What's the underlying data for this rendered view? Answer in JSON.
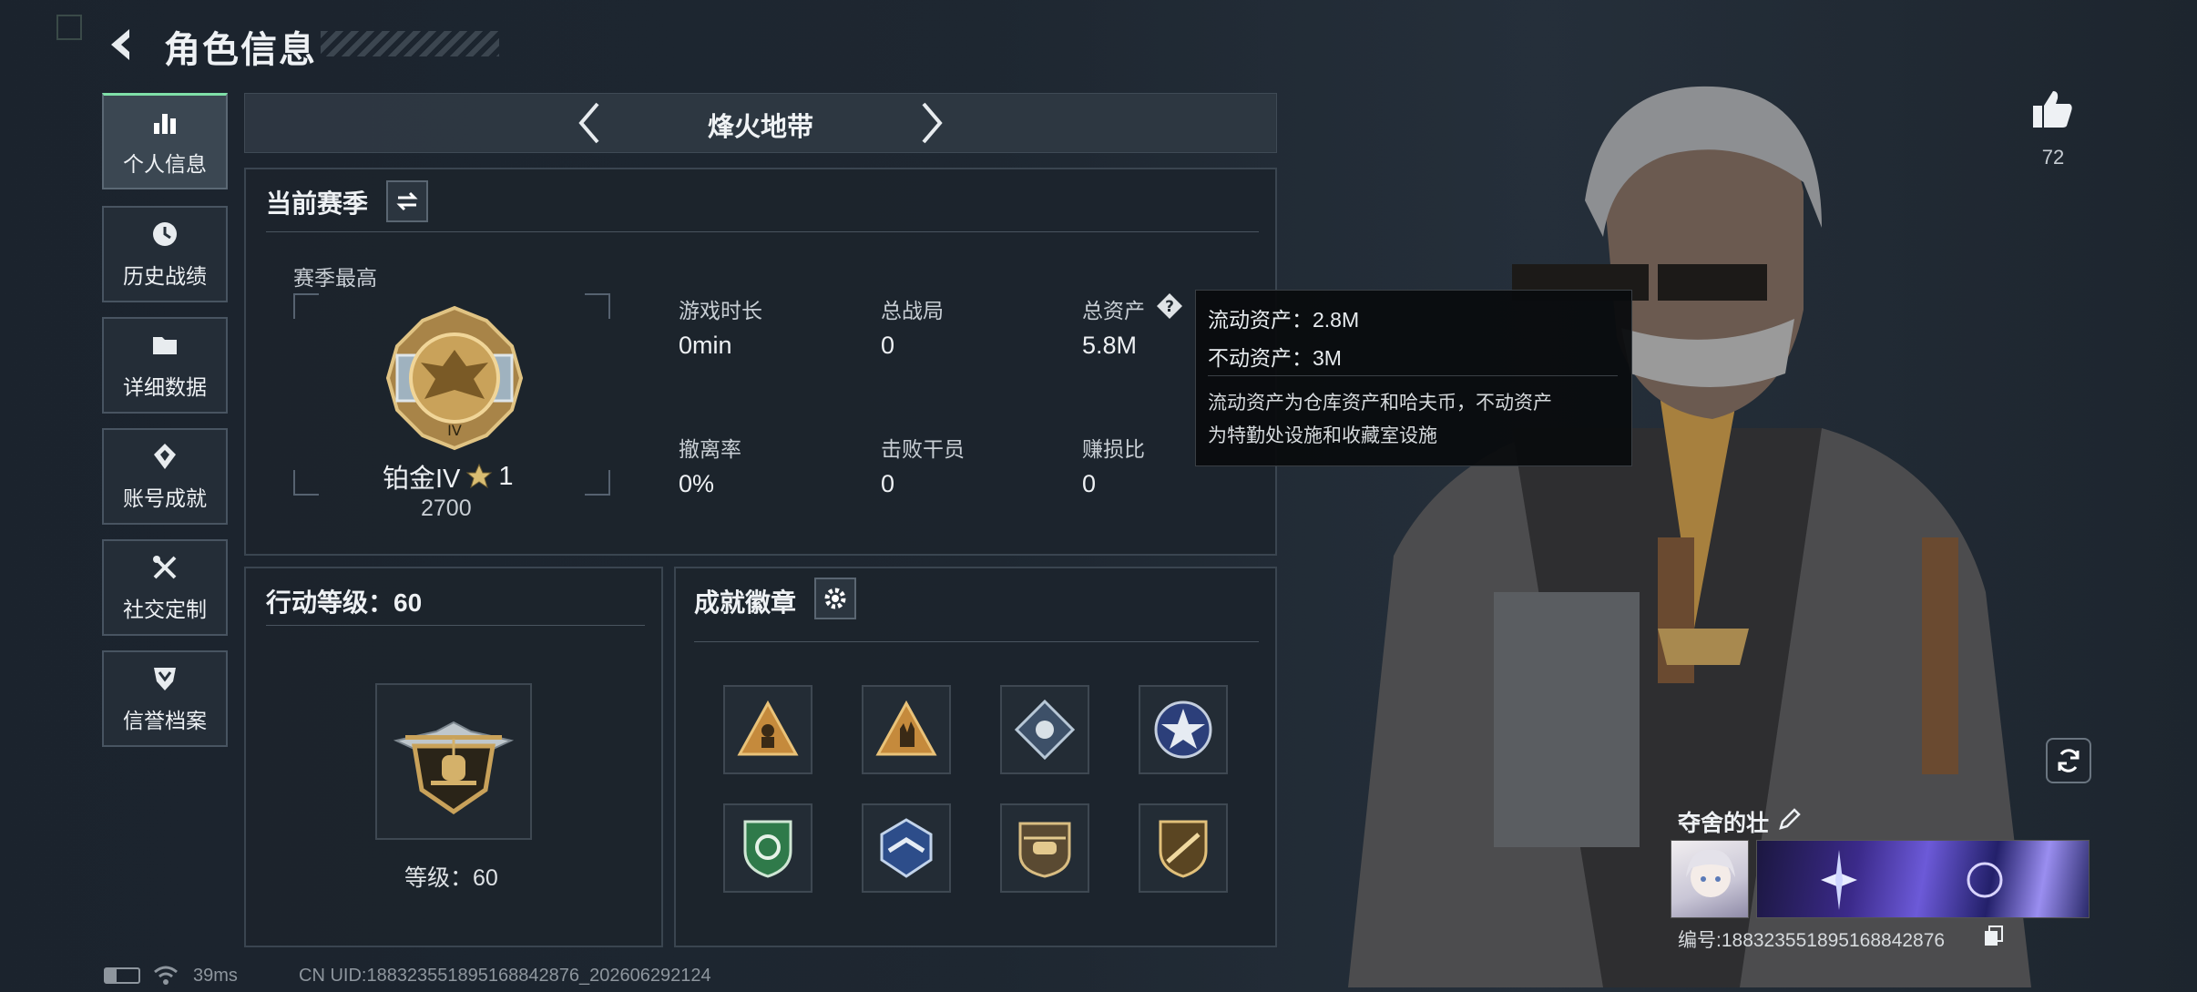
{
  "header": {
    "title": "角色信息"
  },
  "nav": {
    "items": [
      {
        "label": "个人信息",
        "icon": "bar-chart-icon"
      },
      {
        "label": "历史战绩",
        "icon": "history-icon"
      },
      {
        "label": "详细数据",
        "icon": "folder-icon"
      },
      {
        "label": "账号成就",
        "icon": "achievement-icon"
      },
      {
        "label": "社交定制",
        "icon": "tools-icon"
      },
      {
        "label": "信誉档案",
        "icon": "shield-icon"
      }
    ]
  },
  "mode_selector": {
    "label": "烽火地带"
  },
  "season": {
    "title": "当前赛季",
    "best_label": "赛季最高",
    "rank_name": "铂金IV",
    "rank_stars": "1",
    "rank_points": "2700",
    "stats": [
      {
        "label": "游戏时长",
        "value": "0min"
      },
      {
        "label": "总战局",
        "value": "0"
      },
      {
        "label": "总资产",
        "value": "5.8M"
      },
      {
        "label": "撤离率",
        "value": "0%"
      },
      {
        "label": "击败干员",
        "value": "0"
      },
      {
        "label": "赚损比",
        "value": "0"
      }
    ]
  },
  "tooltip": {
    "line1": "流动资产：2.8M",
    "line2": "不动资产：3M",
    "desc1": "流动资产为仓库资产和哈夫币，不动资产",
    "desc2": "为特勤处设施和收藏室设施"
  },
  "action_level": {
    "title": "行动等级：60",
    "level_text": "等级：60"
  },
  "achievements": {
    "title": "成就徽章",
    "count": 8
  },
  "player": {
    "likes": "72",
    "name": "夺舍的壮",
    "id_text": "编号:1883235518951688428​76"
  },
  "status_bar": {
    "ping": "39ms",
    "uid_text": "CN UID:1883235518951688428​76_202606292124"
  },
  "colors": {
    "accent_green": "#7fe0a8",
    "gold": "#c9a25a",
    "panel_bg": "#1c242c"
  }
}
